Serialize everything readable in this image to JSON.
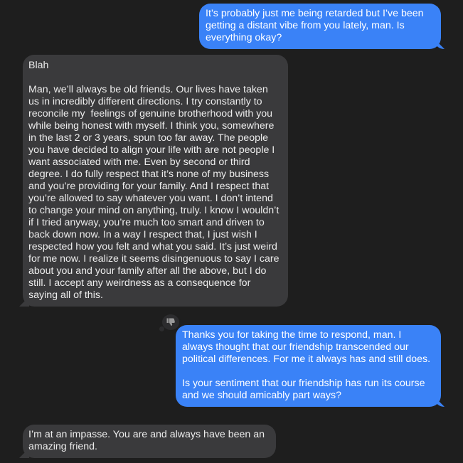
{
  "messages": [
    {
      "id": "msg1",
      "direction": "sent",
      "text": "It’s probably just me being retarded but I’ve been getting a distant vibe from you lately, man. Is everything okay?"
    },
    {
      "id": "msg2",
      "direction": "received",
      "text": "Blah\n\nMan, we’ll always be old friends. Our lives have taken us in incredibly different directions. I try constantly to reconcile my  feelings of genuine brotherhood with you while being honest with myself. I think you, somewhere in the last 2 or 3 years, spun too far away. The people you have decided to align your life with are not people I want associated with me. Even by second or third degree. I do fully respect that it’s none of my business and you’re providing for your family. And I respect that you’re allowed to say whatever you want. I don’t intend to change your mind on anything, truly. I know I wouldn’t if I tried anyway, you’re much too smart and driven to back down now. In a way I respect that, I just wish I respected how you felt and what you said. It’s just weird for me now. I realize it seems disingenuous to say I care about you and your family after all the above, but I do still. I accept any weirdness as a consequence for saying all of this.",
      "reaction": "thumbs-down-icon"
    },
    {
      "id": "msg3",
      "direction": "sent",
      "text": "Thanks you for taking the time to respond, man. I always thought that our friendship transcended our political differences. For me it always has and still does.\n\nIs your sentiment that our friendship has run its course and we should amicably part ways?"
    },
    {
      "id": "msg4",
      "direction": "received",
      "text": "I’m at an impasse. You are and always have been an amazing friend."
    }
  ],
  "colors": {
    "background": "#1e1e1e",
    "sent_bubble": "#3a82f7",
    "received_bubble": "#3a3a3c"
  }
}
